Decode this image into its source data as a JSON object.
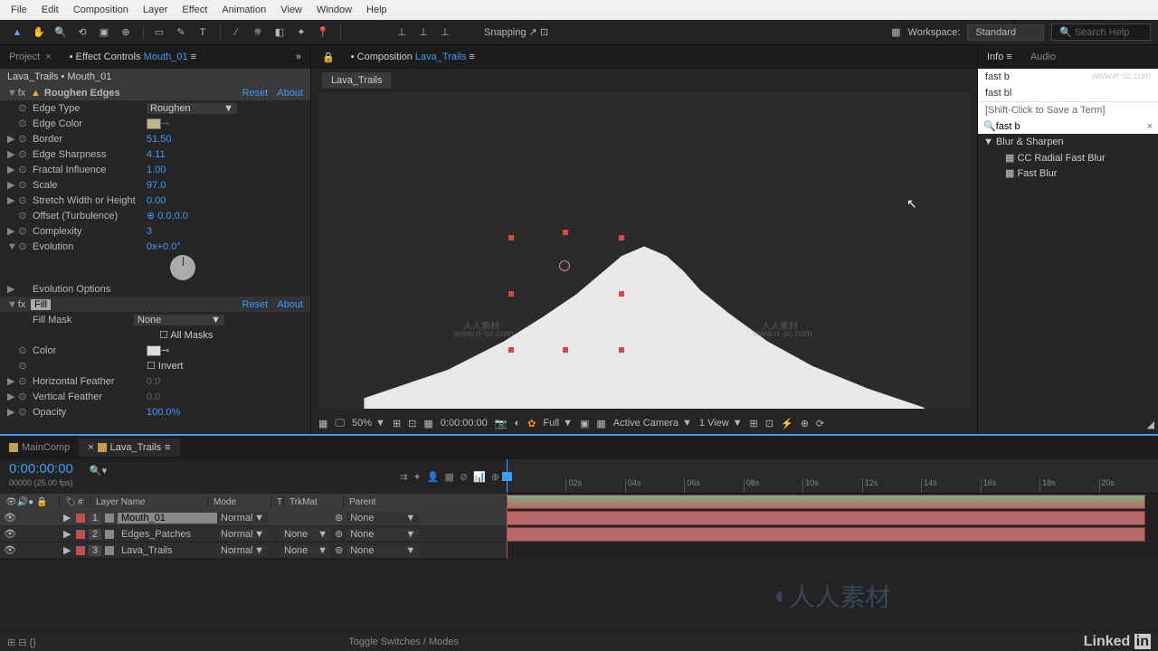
{
  "menu": [
    "File",
    "Edit",
    "Composition",
    "Layer",
    "Effect",
    "Animation",
    "View",
    "Window",
    "Help"
  ],
  "toolbar": {
    "snapping": "Snapping",
    "workspace_label": "Workspace:",
    "workspace_value": "Standard",
    "search_help": "Search Help"
  },
  "leftPanel": {
    "tabs": {
      "project": "Project",
      "effectControls": "Effect Controls",
      "ecTarget": "Mouth_01"
    },
    "breadcrumb": "Lava_Trails • Mouth_01",
    "fx1": {
      "name": "Roughen Edges",
      "reset": "Reset",
      "about": "About"
    },
    "p_edgeType": {
      "n": "Edge Type",
      "v": "Roughen"
    },
    "p_edgeColor": {
      "n": "Edge Color"
    },
    "p_border": {
      "n": "Border",
      "v": "51.50"
    },
    "p_sharp": {
      "n": "Edge Sharpness",
      "v": "4.11"
    },
    "p_fractal": {
      "n": "Fractal Influence",
      "v": "1.00"
    },
    "p_scale": {
      "n": "Scale",
      "v": "97.0"
    },
    "p_stretch": {
      "n": "Stretch Width or Height",
      "v": "0.00"
    },
    "p_offset": {
      "n": "Offset (Turbulence)",
      "v": "0.0,0.0"
    },
    "p_complex": {
      "n": "Complexity",
      "v": "3"
    },
    "p_evo": {
      "n": "Evolution",
      "v": "0x+0.0°"
    },
    "p_evoOpt": {
      "n": "Evolution Options"
    },
    "fx2": {
      "name": "Fill",
      "reset": "Reset",
      "about": "About"
    },
    "p_fillMask": {
      "n": "Fill Mask",
      "v": "None"
    },
    "p_allMasks": {
      "n": "All Masks"
    },
    "p_color": {
      "n": "Color"
    },
    "p_invert": {
      "n": "Invert"
    },
    "p_hfeather": {
      "n": "Horizontal Feather",
      "v": "0.0"
    },
    "p_vfeather": {
      "n": "Vertical Feather",
      "v": "0.0"
    },
    "p_opacity": {
      "n": "Opacity",
      "v": "100.0%"
    }
  },
  "centerPanel": {
    "tab": "Composition",
    "tabTarget": "Lava_Trails",
    "activeComp": "Lava_Trails",
    "zoom": "50%",
    "time": "0:00:00:00",
    "res": "Full",
    "camera": "Active Camera",
    "views": "1 View"
  },
  "rightPanel": {
    "tabs": {
      "info": "Info",
      "audio": "Audio"
    },
    "suggestions": [
      "fast b",
      "fast bl"
    ],
    "hint": "[Shift-Click to Save a Term]",
    "searchValue": "fast b",
    "category": "Blur & Sharpen",
    "items": [
      "CC Radial Fast Blur",
      "Fast Blur"
    ]
  },
  "timeline": {
    "tabs": {
      "main": "MainComp",
      "lava": "Lava_Trails"
    },
    "timecode": "0:00:00:00",
    "fps": "00000 (25.00 fps)",
    "ruler": [
      "",
      "02s",
      "04s",
      "06s",
      "08s",
      "10s",
      "12s",
      "14s",
      "16s",
      "18s",
      "20s"
    ],
    "cols": {
      "layerName": "Layer Name",
      "mode": "Mode",
      "t": "T",
      "trkMat": "TrkMat",
      "parent": "Parent",
      "num": "#"
    },
    "layers": [
      {
        "num": "1",
        "name": "Mouth_01",
        "mode": "Normal",
        "trk": "",
        "parent": "None",
        "sel": true
      },
      {
        "num": "2",
        "name": "Edges_Patches",
        "mode": "Normal",
        "trk": "None",
        "parent": "None",
        "sel": false
      },
      {
        "num": "3",
        "name": "Lava_Trails",
        "mode": "Normal",
        "trk": "None",
        "parent": "None",
        "sel": false
      }
    ],
    "footer": "Toggle Switches / Modes"
  },
  "watermark": {
    "site": "www.rr-sc.com",
    "brand": "人人素材"
  }
}
